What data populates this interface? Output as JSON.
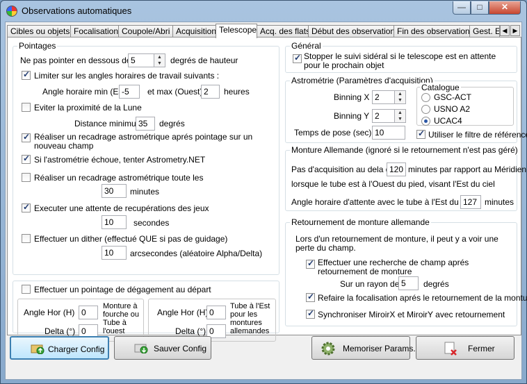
{
  "window": {
    "title": "Observations automatiques",
    "min_glyph": "—",
    "max_glyph": "□",
    "close_glyph": "✕"
  },
  "tabs": [
    {
      "label": "Cibles ou objets"
    },
    {
      "label": "Focalisation"
    },
    {
      "label": "Coupole/Abri"
    },
    {
      "label": "Acquisition"
    },
    {
      "label": "Telescope"
    },
    {
      "label": "Acq. des flats"
    },
    {
      "label": "Début des observations"
    },
    {
      "label": "Fin des observations"
    },
    {
      "label": "Gest. Er"
    }
  ],
  "tab_scroll": {
    "left": "◀",
    "right": "▶"
  },
  "spin_glyphs": {
    "up": "▲",
    "down": "▼"
  },
  "pointages": {
    "title": "Pointages",
    "min_height_prefix": "Ne pas pointer en dessous de",
    "min_height_value": "5",
    "min_height_suffix": "degrés de hauteur",
    "limit_hour_angle_label": "Limiter sur les angles horaires de travail suivants :",
    "limit_hour_angle_checked": true,
    "ha_min_label": "Angle horaire min (Est)",
    "ha_min_value": "-5",
    "ha_max_label": "et max (Ouest)",
    "ha_max_value": "2",
    "ha_unit": "heures",
    "avoid_moon_label": "Eviter la proximité de la Lune",
    "avoid_moon_checked": false,
    "min_distance_label": "Distance minimum",
    "min_distance_value": "35",
    "min_distance_unit": "degrés",
    "recenter_label": "Réaliser un recadrage astrométrique aprés pointage sur un nouveau champ",
    "recenter_checked": true,
    "astrometry_net_label": "Si l'astrométrie échoue, tenter Astrometry.NET",
    "astrometry_net_checked": true,
    "periodic_recenter_label": "Réaliser un recadrage astrométrique toute les",
    "periodic_recenter_checked": false,
    "periodic_value": "30",
    "periodic_unit": "minutes",
    "wait_recovery_label": "Executer une attente de recupérations des jeux",
    "wait_recovery_checked": true,
    "wait_value": "10",
    "wait_unit": "secondes",
    "dither_label": "Effectuer un dither (effectué QUE si pas de guidage)",
    "dither_checked": false,
    "dither_value": "10",
    "dither_unit": "arcsecondes (aléatoire Alpha/Delta)"
  },
  "degagement": {
    "checkbox_label": "Effectuer un pointage de dégagement au départ",
    "checked": false,
    "fork": {
      "ha_label": "Angle Hor (H)",
      "ha_value": "0",
      "delta_label": "Delta (°)",
      "delta_value": "0",
      "note": "Monture à fourche ou Tube à l'ouest"
    },
    "german": {
      "ha_label": "Angle Hor (H)",
      "ha_value": "0",
      "delta_label": "Delta (°)",
      "delta_value": "0",
      "note": "Tube à l'Est pour les montures allemandes"
    }
  },
  "general": {
    "title": "Général",
    "stop_tracking_label": "Stopper le suivi sidéral si le telescope est en attente pour le prochain objet",
    "stop_tracking_checked": true
  },
  "astrometrie": {
    "title": "Astrométrie (Paramètres d'acquisition)",
    "binning_x_label": "Binning X :",
    "binning_x_value": "2",
    "binning_y_label": "Binning Y :",
    "binning_y_value": "2",
    "exposure_label": "Temps de pose (sec) :",
    "exposure_value": "10",
    "catalogue_title": "Catalogue",
    "catalogues": [
      {
        "label": "GSC-ACT",
        "selected": false
      },
      {
        "label": "USNO A2",
        "selected": false
      },
      {
        "label": "UCAC4",
        "selected": true
      }
    ],
    "ref_filter_label": "Utiliser le filtre de référence",
    "ref_filter_checked": true
  },
  "monture": {
    "title": "Monture Allemande (ignoré si le retournement n'est pas géré)",
    "line1_prefix": "Pas d'acquisition au dela de",
    "line1_value": "120",
    "line1_suffix": "minutes par rapport au Méridien",
    "line2": "lorsque le tube est à l'Ouest du pied, visant l'Est du ciel",
    "line3_prefix": "Angle horaire d'attente avec le tube à l'Est du pied",
    "line3_value": "127",
    "line3_suffix": "minutes"
  },
  "retournement": {
    "title": "Retournement de monture allemande",
    "intro": "Lors d'un retournement de monture, il peut y a voir une perte du champ.",
    "search_label": "Effectuer une recherche de champ aprés retournement de monture",
    "search_checked": true,
    "radius_label": "Sur un rayon de",
    "radius_value": "5",
    "radius_unit": "degrés",
    "refocus_label": "Refaire la focalisation aprés le retournement de la monture",
    "refocus_checked": true,
    "sync_label": "Synchroniser MiroirX et MiroirY avec retournement",
    "sync_checked": true
  },
  "buttons": {
    "load": "Charger Config",
    "save": "Sauver Config",
    "memorize": "Memoriser Params.",
    "close": "Fermer"
  }
}
